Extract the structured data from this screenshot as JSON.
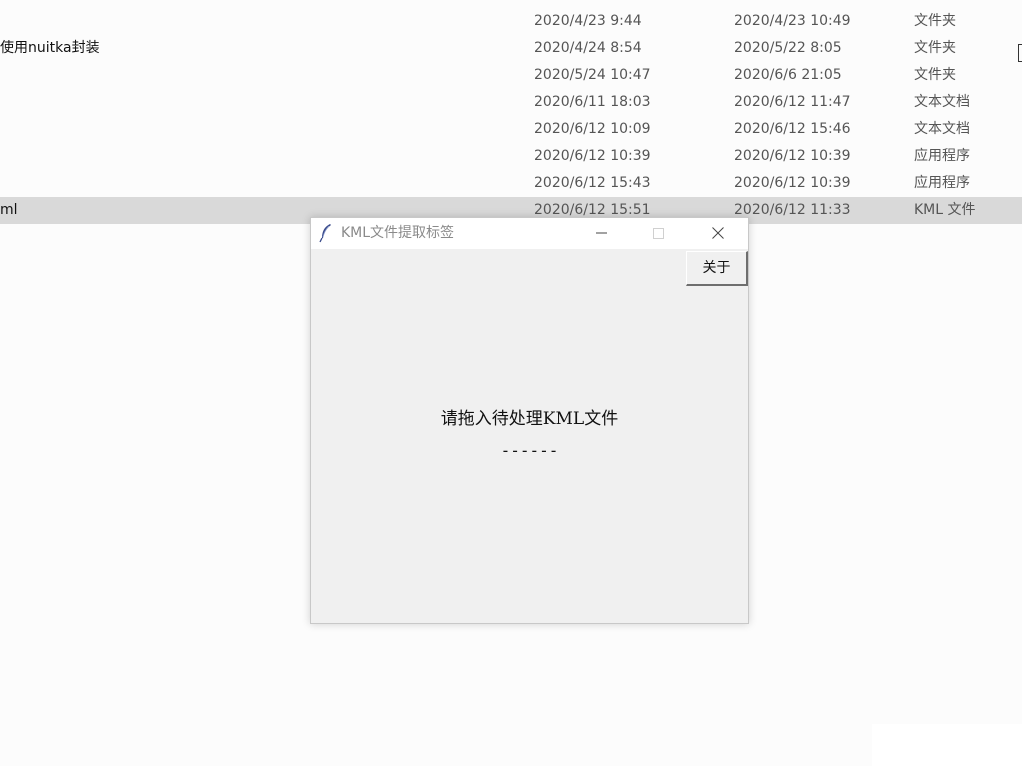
{
  "explorer": {
    "rows": [
      {
        "name": "",
        "modified": "2020/4/23 9:44",
        "created": "2020/4/23 10:49",
        "type": "文件夹"
      },
      {
        "name": "使用nuitka封装",
        "modified": "2020/4/24 8:54",
        "created": "2020/5/22 8:05",
        "type": "文件夹"
      },
      {
        "name": "",
        "modified": "2020/5/24 10:47",
        "created": "2020/6/6 21:05",
        "type": "文件夹"
      },
      {
        "name": "",
        "modified": "2020/6/11 18:03",
        "created": "2020/6/12 11:47",
        "type": "文本文档"
      },
      {
        "name": "",
        "modified": "2020/6/12 10:09",
        "created": "2020/6/12 15:46",
        "type": "文本文档"
      },
      {
        "name": "",
        "modified": "2020/6/12 10:39",
        "created": "2020/6/12 10:39",
        "type": "应用程序"
      },
      {
        "name": "",
        "modified": "2020/6/12 15:43",
        "created": "2020/6/12 10:39",
        "type": "应用程序"
      },
      {
        "name": "ml",
        "modified": "2020/6/12 15:51",
        "created": "2020/6/12 11:33",
        "type": "KML 文件"
      }
    ]
  },
  "dialog": {
    "title": "KML文件提取标签",
    "icon": "feather-icon",
    "about_label": "关于",
    "prompt": "请拖入待处理KML文件",
    "status": "------"
  },
  "colors": {
    "selected_row": "#d9d9d9",
    "dialog_bg": "#f0f0f0",
    "titlebar_bg": "#ffffff",
    "title_text": "#8a8a8a"
  }
}
